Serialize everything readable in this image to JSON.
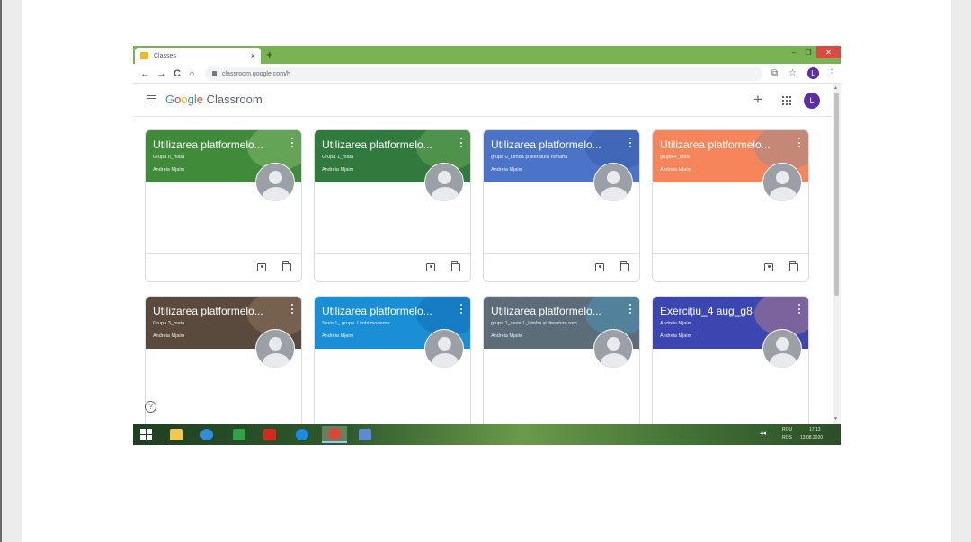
{
  "browser": {
    "tab_title": "Classes",
    "tab_close": "×",
    "new_tab": "+",
    "window_controls": {
      "minimize": "–",
      "maximize": "❐",
      "close": "✕"
    },
    "nav": {
      "back": "←",
      "forward": "→",
      "reload": "C",
      "home": "⌂"
    },
    "url": "classroom.google.com/h",
    "avatar_letter": "L"
  },
  "app": {
    "logo_google": [
      "G",
      "o",
      "o",
      "g",
      "l",
      "e"
    ],
    "logo_product": "Classroom",
    "add_label": "+",
    "user_initial": "L",
    "help_label": "?"
  },
  "colors": {
    "tabstrip": "#79b452",
    "banner_green": "#3f8b3a",
    "banner_green2": "#2f7a3c",
    "banner_blue": "#4b74c9",
    "banner_orange": "#f7855b",
    "banner_brown": "#5a4a3e",
    "banner_lightblue": "#1b8fd6",
    "banner_gray": "#5c6c79",
    "banner_indigo": "#3c46b0"
  },
  "courses": [
    {
      "title": "Utilizarea platformelo...",
      "section": "Grupa II_mata",
      "teacher": "Andreia Mjaim",
      "color": "#3f8b3a",
      "deco": "#a9d48b"
    },
    {
      "title": "Utilizarea platformelo...",
      "section": "Grupa 1_mata",
      "teacher": "Andreia Mjaim",
      "color": "#2f7a3c",
      "deco": "#8cc06a"
    },
    {
      "title": "Utilizarea platformelo...",
      "section": "grupa 0_Limba și literatura română",
      "teacher": "Andreia Mjaim",
      "color": "#4b74c9",
      "deco": "#2e4f99"
    },
    {
      "title": "Utilizarea platformelo...",
      "section": "grupa 4_mata",
      "teacher": "Andreia Mjaim",
      "color": "#f7855b",
      "deco": "#6a8fa8"
    },
    {
      "title": "Utilizarea platformelo...",
      "section": "Grupa 3_mata",
      "teacher": "Andreia Mjaim",
      "color": "#5a4a3e",
      "deco": "#a88c6c"
    },
    {
      "title": "Utilizarea platformelo...",
      "section": "Seria 1_ grupa. Limbi moderne",
      "teacher": "Andreia Mjaim",
      "color": "#1b8fd6",
      "deco": "#0e5aa0"
    },
    {
      "title": "Utilizarea platformelo...",
      "section": "grupa 1_seria 1_Limba și literatura rom",
      "teacher": "Andreia Mjaim",
      "color": "#5c6c79",
      "deco": "#3fa9e0"
    },
    {
      "title": "Exercițiu_4 aug_g8",
      "section": "Andreia Mjaim",
      "teacher": "Andreia Mjaim",
      "color": "#3c46b0",
      "deco": "#f29a7a"
    }
  ],
  "taskbar": {
    "apps": [
      {
        "name": "file-explorer",
        "color": "#f2c94c"
      },
      {
        "name": "internet-explorer",
        "color": "#2f8fdc"
      },
      {
        "name": "store",
        "color": "#2fa24a"
      },
      {
        "name": "acrobat",
        "color": "#d7281e"
      },
      {
        "name": "edge",
        "color": "#1e88e5"
      },
      {
        "name": "chrome",
        "color": "#e0453a"
      },
      {
        "name": "app-window",
        "color": "#5b8bd6"
      }
    ],
    "lang_top": "ROU",
    "lang_bottom": "ROS",
    "time": "17:13",
    "date": "13.08.2020"
  }
}
